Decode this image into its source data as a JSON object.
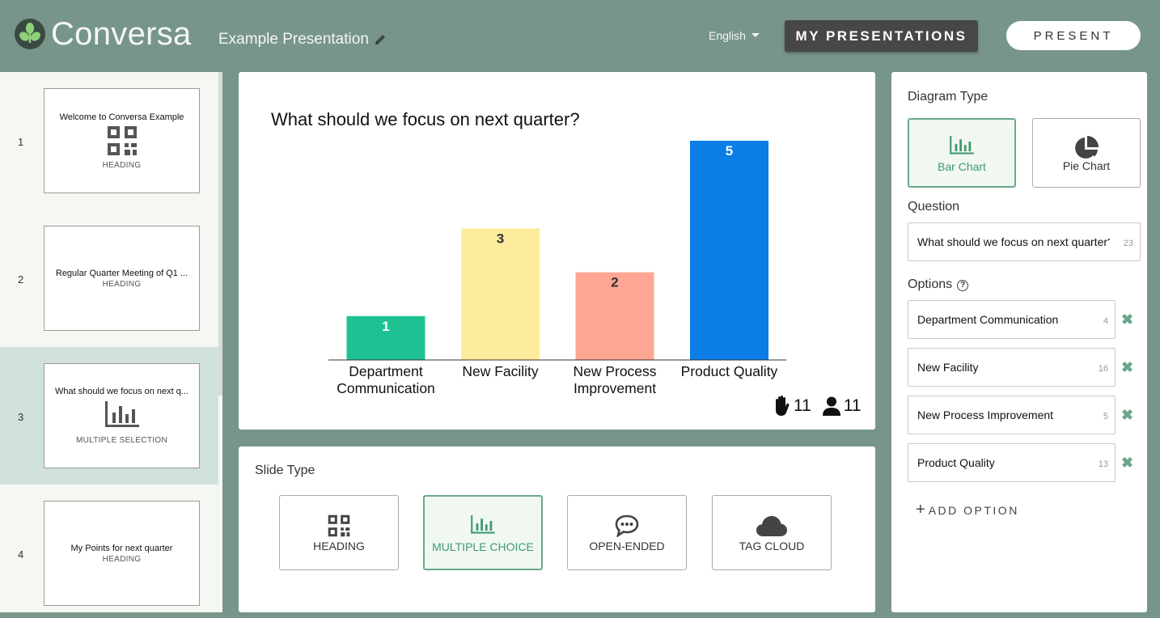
{
  "header": {
    "brand": "Conversa",
    "presentation_title": "Example Presentation",
    "language": "English",
    "my_presentations_label": "MY PRESENTATIONS",
    "present_label": "PRESENT"
  },
  "slides": [
    {
      "number": "1",
      "title": "Welcome to Conversa Example",
      "type": "HEADING",
      "icon": "qr-code-icon"
    },
    {
      "number": "2",
      "title": "Regular Quarter Meeting of Q1 ...",
      "type": "HEADING",
      "icon": ""
    },
    {
      "number": "3",
      "title": "What should we focus on next q...",
      "type": "MULTIPLE SELECTION",
      "icon": "bar-chart-icon",
      "active": true
    },
    {
      "number": "4",
      "title": "My Points for next quarter",
      "type": "HEADING",
      "icon": ""
    }
  ],
  "preview": {
    "question": "What should we focus on next quarter?",
    "votes_count": "11",
    "participants_count": "11"
  },
  "chart_data": {
    "type": "bar",
    "title": "What should we focus on next quarter?",
    "categories": [
      "Department Communication",
      "New Facility",
      "New Process Improvement",
      "Product Quality"
    ],
    "category_lines": [
      [
        "Department",
        "Communication"
      ],
      [
        "New Facility"
      ],
      [
        "New Process",
        "Improvement"
      ],
      [
        "Product Quality"
      ]
    ],
    "values": [
      1,
      3,
      2,
      5
    ],
    "colors": [
      "#1ec292",
      "#feec9d",
      "#fea693",
      "#0a7de6"
    ],
    "ylim": [
      0,
      5
    ],
    "xlabel": "",
    "ylabel": "",
    "grid": false,
    "data_labels": true
  },
  "slide_type": {
    "label": "Slide Type",
    "options": [
      {
        "label": "HEADING",
        "icon": "qr-code-icon"
      },
      {
        "label": "MULTIPLE CHOICE",
        "icon": "bar-chart-icon",
        "selected": true
      },
      {
        "label": "OPEN-ENDED",
        "icon": "speech-bubble-icon"
      },
      {
        "label": "TAG CLOUD",
        "icon": "cloud-icon"
      }
    ]
  },
  "panel": {
    "diagram_type_label": "Diagram Type",
    "diagram_options": [
      {
        "label": "Bar Chart",
        "icon": "bar-chart-icon",
        "selected": true
      },
      {
        "label": "Pie Chart",
        "icon": "pie-chart-icon"
      }
    ],
    "question_label": "Question",
    "question_value": "What should we focus on next quarter?",
    "question_count": "23",
    "options_label": "Options",
    "options": [
      {
        "value": "Department Communication",
        "count": "4"
      },
      {
        "value": "New Facility",
        "count": "16"
      },
      {
        "value": "New Process Improvement",
        "count": "5"
      },
      {
        "value": "Product Quality",
        "count": "13"
      }
    ],
    "add_option_label": "ADD OPTION"
  },
  "colors": {
    "background": "#78958a",
    "accent": "#6aa88a",
    "accent_text": "#3f9b6f"
  }
}
